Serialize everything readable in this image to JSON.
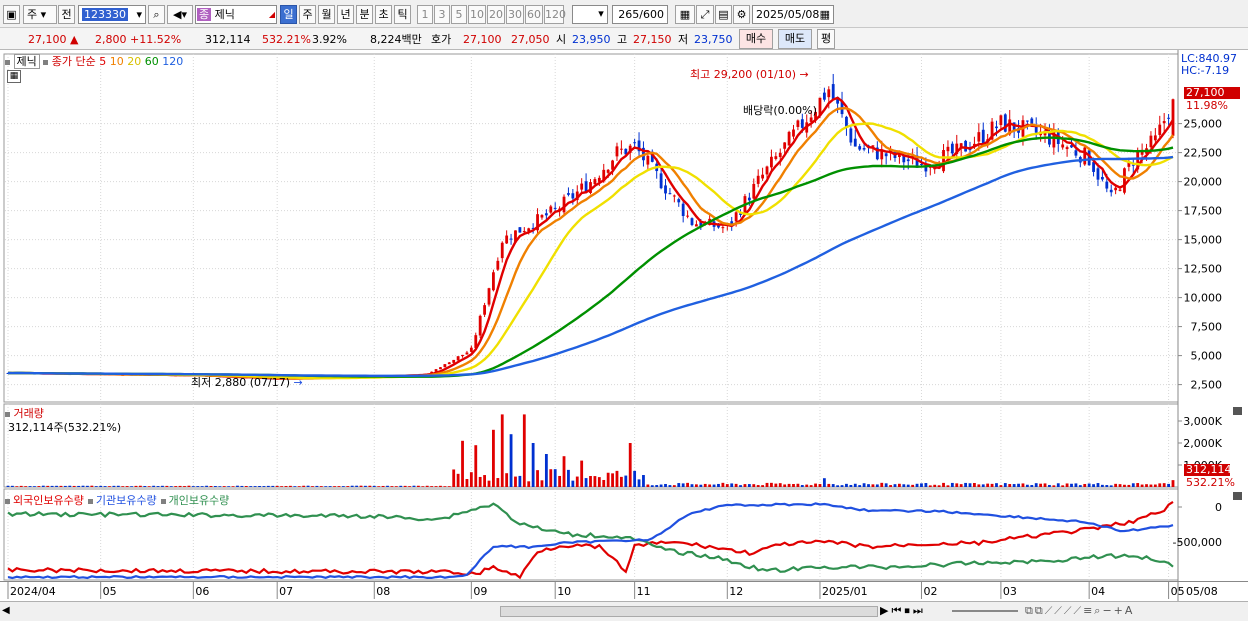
{
  "toolbar": {
    "market": "주",
    "prev_label": "전",
    "code": "123330",
    "stock_name": "제닉",
    "stock_badge": "종",
    "periods": [
      "일",
      "주",
      "월",
      "년",
      "분",
      "초",
      "틱"
    ],
    "active_period": "일",
    "intervals": [
      "1",
      "3",
      "5",
      "10",
      "20",
      "30",
      "60",
      "120"
    ],
    "count": "265",
    "count_max": "/600",
    "date": "2025/05/08"
  },
  "quote": {
    "price": "27,100",
    "change": "2,800",
    "change_pct": "+11.52%",
    "volume": "312,114",
    "volume_pct": "532.21%",
    "turnover_pct": "3.92%",
    "amount": "8,224백만",
    "hoga_label": "호가",
    "ask": "27,100",
    "bid": "27,050",
    "open_label": "시",
    "open": "23,950",
    "high_label": "고",
    "high": "27,150",
    "low_label": "저",
    "low": "23,750",
    "buy_label": "매수",
    "sell_label": "매도",
    "eval_label": "평"
  },
  "price_panel": {
    "name": "제닉",
    "ma_title": "종가 단순",
    "ma_periods": [
      "5",
      "10",
      "20",
      "60",
      "120"
    ],
    "lc": "LC:840.97",
    "hc": "HC:-7.19",
    "current_price": "27,100",
    "current_pct": "11.98%",
    "high_annot": "최고 29,200 (01/10)",
    "low_annot": "최저 2,880 (07/17)",
    "dividend_annot": "배당락(0.00%)"
  },
  "volume_panel": {
    "title": "거래량",
    "subtitle": "312,114주(532.21%)",
    "current": "312,114",
    "current_pct": "532.21%"
  },
  "holding_panel": {
    "series": [
      "외국인보유수량",
      "기관보유수량",
      "개인보유수량"
    ]
  },
  "x_axis": {
    "labels": [
      "2024/04",
      "05",
      "06",
      "07",
      "08",
      "09",
      "10",
      "11",
      "12",
      "2025/01",
      "02",
      "03",
      "04",
      "05"
    ],
    "right_label": "05/08"
  },
  "chart_data": [
    {
      "type": "candlestick",
      "title": "제닉",
      "x_months": [
        "2024/04",
        "05",
        "06",
        "07",
        "08",
        "09",
        "10",
        "11",
        "12",
        "2025/01",
        "02",
        "03",
        "04",
        "05"
      ],
      "ylim": [
        1000,
        31000
      ],
      "yticks": [
        2500,
        5000,
        7500,
        10000,
        12500,
        15000,
        17500,
        20000,
        22500,
        25000
      ],
      "close_approx": [
        [
          "2024/04",
          3500
        ],
        [
          "2024/06",
          3300
        ],
        [
          "2024/07",
          3000
        ],
        [
          "2024/08",
          3200
        ],
        [
          "2024/08 late",
          3400
        ],
        [
          "2024/09",
          5500
        ],
        [
          "2024/09 mid",
          15000
        ],
        [
          "2024/10",
          17500
        ],
        [
          "2024/10 mid",
          20000
        ],
        [
          "2024/10 late",
          22500
        ],
        [
          "2024/11",
          23000
        ],
        [
          "2024/11 mid",
          19000
        ],
        [
          "2024/11 late",
          17000
        ],
        [
          "2024/12",
          16000
        ],
        [
          "2024/12 mid",
          20000
        ],
        [
          "2024/12 late",
          24000
        ],
        [
          "2025/01",
          28000
        ],
        [
          "2025/01 mid",
          23000
        ],
        [
          "2025/02",
          21500
        ],
        [
          "2025/02 mid",
          22500
        ],
        [
          "2025/03",
          25000
        ],
        [
          "2025/03 mid",
          24000
        ],
        [
          "2025/04",
          22000
        ],
        [
          "2025/04 mid",
          18500
        ],
        [
          "2025/04 late",
          22000
        ],
        [
          "2025/05",
          23500
        ],
        [
          "2025/05/08",
          27100
        ]
      ],
      "moving_averages": [
        {
          "name": "5",
          "color": "#e00000"
        },
        {
          "name": "10",
          "color": "#f08000"
        },
        {
          "name": "20",
          "color": "#f0e000"
        },
        {
          "name": "60",
          "color": "#009000"
        },
        {
          "name": "120",
          "color": "#2060e0"
        }
      ],
      "annotations": [
        "최고 29,200 (01/10)",
        "최저 2,880 (07/17)",
        "배당락(0.00%)"
      ],
      "last_price": 27100,
      "last_pct": "11.98%"
    },
    {
      "type": "bar",
      "title": "거래량",
      "ylim": [
        0,
        3500000
      ],
      "yticks": [
        1000000,
        2000000,
        3000000
      ],
      "ytick_labels": [
        "1,000K",
        "2,000K",
        "3,000K"
      ],
      "peaks_approx": [
        [
          "2024/09",
          2100000
        ],
        [
          "2024/09 mid",
          3300000
        ],
        [
          "2024/09 late",
          2000000
        ],
        [
          "2024/10",
          1500000
        ],
        [
          "2024/10 late",
          2000000
        ]
      ],
      "last_value": 312114
    },
    {
      "type": "line",
      "title": "보유수량",
      "series": [
        {
          "name": "외국인보유수량",
          "color": "#e00000"
        },
        {
          "name": "기관보유수량",
          "color": "#2050e0"
        },
        {
          "name": "개인보유수량",
          "color": "#309050"
        }
      ],
      "yticks": [
        0,
        -500000
      ],
      "ytick_labels": [
        "0",
        "-500,000"
      ]
    }
  ]
}
